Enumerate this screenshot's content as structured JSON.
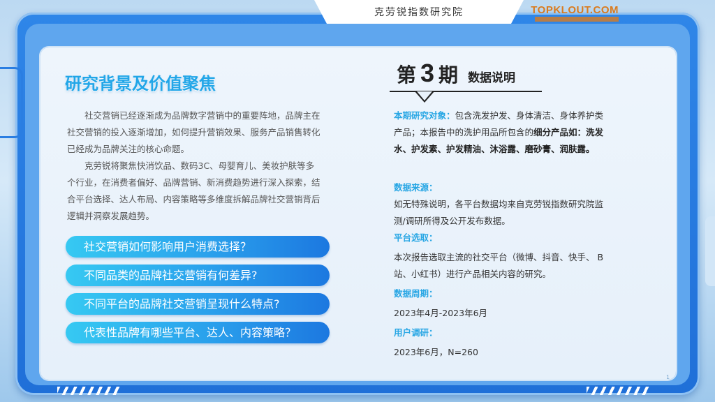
{
  "header": {
    "title": "克劳锐指数研究院",
    "logo": "TOPKLOUT.COM"
  },
  "left": {
    "heading": "研究背景及价值聚焦",
    "paragraphs": [
      "社交营销已经逐渐成为品牌数字营销中的重要阵地，品牌主在社交营销的投入逐渐增加，如何提升营销效果、服务产品销售转化已经成为品牌关注的核心命题。",
      "克劳锐将聚焦快消饮品、数码3C、母婴育儿、美妆护肤等多个行业，在消费者偏好、品牌营销、新消费趋势进行深入探索，结合平台选择、达人布局、内容策略等多维度拆解品牌社交营销背后逻辑并洞察发展趋势。"
    ],
    "questions": [
      "社交营销如何影响用户消费选择？",
      "不同品类的品牌社交营销有何差异?",
      "不同平台的品牌社交营销呈现什么特点?",
      "代表性品牌有哪些平台、达人、内容策略？"
    ]
  },
  "right": {
    "issue_prefix": "第",
    "issue_number": "3",
    "issue_suffix": "期",
    "issue_desc": "数据说明",
    "object_label": "本期研究对象：",
    "object_text1": "包含洗发护发、身体清洁、身体养护类产品；本报告中的洗护用品所包含的",
    "object_bold": "细分产品如：洗发水、护发素、护发精油、沐浴露、磨砂膏、润肤露。",
    "source_label": "数据来源：",
    "source_text": "如无特殊说明，各平台数据均来自克劳锐指数研究院监测/调研所得及公开发布数据。",
    "platform_label": "平台选取：",
    "platform_text": "本次报告选取主流的社交平台（微博、抖音、快手、 B站、小红书）进行产品相关内容的研究。",
    "period_label": "数据周期：",
    "period_text": "2023年4月-2023年6月",
    "survey_label": "用户调研：",
    "survey_text": "2023年6月，N=260"
  },
  "footer": {
    "page_number": "1"
  },
  "colors": {
    "frame": "#2f86e8",
    "accent": "#27a6e4",
    "button": "#2aa0ec"
  }
}
